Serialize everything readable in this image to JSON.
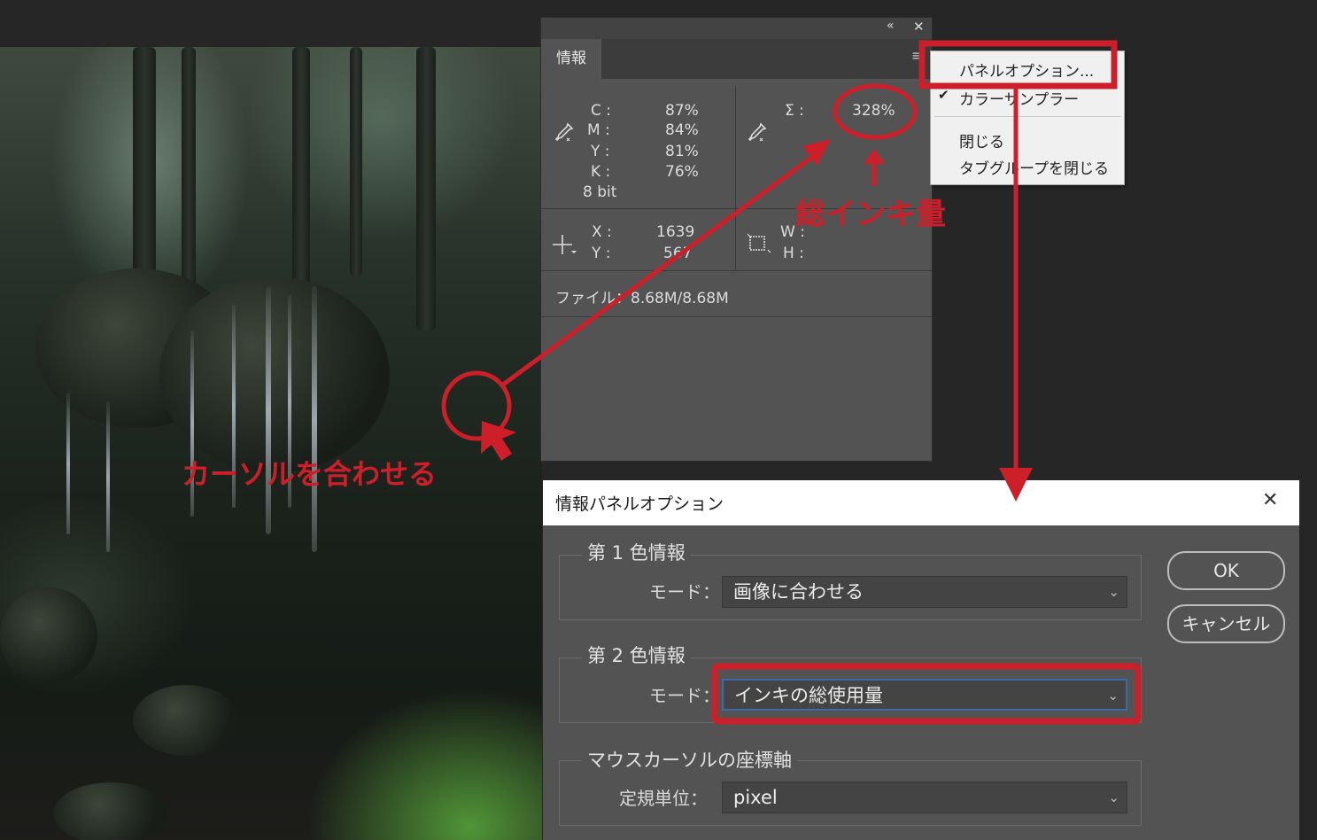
{
  "info_panel": {
    "collapse_glyph": "«",
    "close_glyph": "✕",
    "menu_glyph": "≡",
    "tab_label": "情報",
    "cmyk": {
      "c_label": "C :",
      "m_label": "M :",
      "y_label": "Y :",
      "k_label": "K :",
      "c_value": "87%",
      "m_value": "84%",
      "y_value": "81%",
      "k_value": "76%",
      "bit_depth": "8 bit"
    },
    "total_ink": {
      "label": "Σ :",
      "value": "328%"
    },
    "position": {
      "x_label": "X :",
      "y_label": "Y :",
      "x_value": "1639",
      "y_value": "567"
    },
    "size": {
      "w_label": "W :",
      "h_label": "H :"
    },
    "file_info": "ファイル：8.68M/8.68M"
  },
  "context_menu": {
    "items": [
      "パネルオプション...",
      "カラーサンプラー",
      "閉じる",
      "タブグループを閉じる"
    ],
    "check_glyph": "✔"
  },
  "dialog": {
    "title": "情報パネルオプション",
    "close_glyph": "✕",
    "group1": {
      "title": "第 1 色情報",
      "mode_label": "モード：",
      "mode_value": "画像に合わせる"
    },
    "group2": {
      "title": "第 2 色情報",
      "mode_label": "モード：",
      "mode_value": "インキの総使用量"
    },
    "group3": {
      "title": "マウスカーソルの座標軸",
      "unit_label": "定規単位：",
      "unit_value": "pixel"
    },
    "ok_label": "OK",
    "cancel_label": "キャンセル",
    "chevron_glyph": "⌄"
  },
  "annotations": {
    "total_ink_label": "総インキ量",
    "cursor_label": "カーソルを合わせる",
    "color": "#cc1f2a"
  }
}
